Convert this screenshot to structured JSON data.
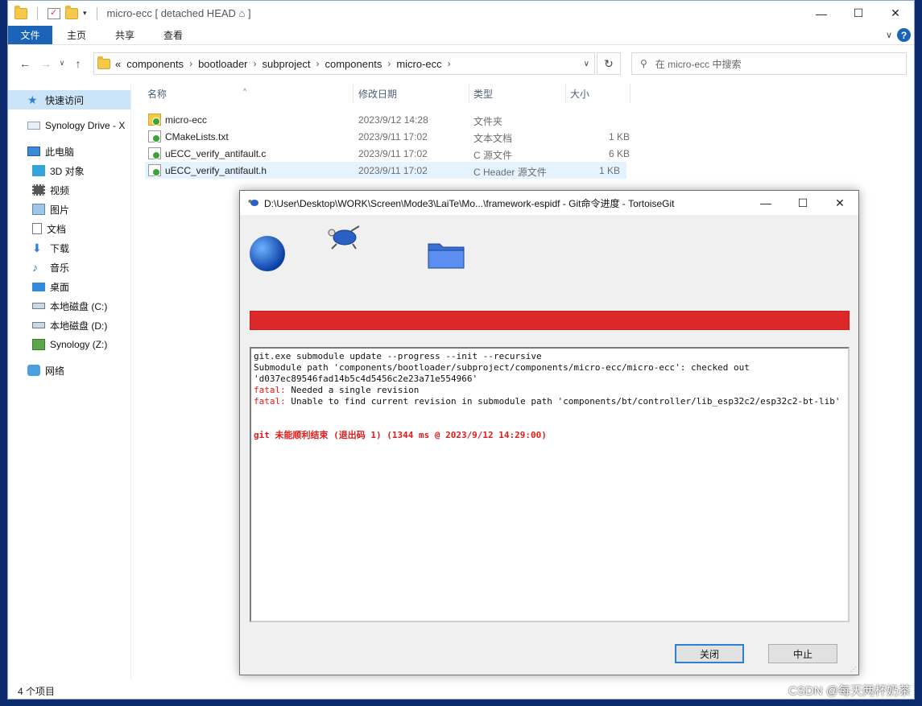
{
  "explorer": {
    "title": "micro-ecc [ detached HEAD ⌂ ]",
    "window_controls": {
      "minimize": "—",
      "maximize": "☐",
      "close": "✕"
    },
    "ribbon": {
      "file": "文件",
      "home": "主页",
      "share": "共享",
      "view": "查看",
      "expand": "∨",
      "help": "?"
    },
    "nav": {
      "back": "←",
      "forward": "→",
      "dropdown": "∨",
      "up": "↑"
    },
    "address": {
      "overflow": "«",
      "segments": [
        "components",
        "bootloader",
        "subproject",
        "components",
        "micro-ecc"
      ],
      "dropdown": "∨"
    },
    "refresh": "↻",
    "search": {
      "placeholder": "在 micro-ecc 中搜索"
    },
    "sidebar": {
      "quick_access": "快速访问",
      "synology_drive": "Synology Drive - X",
      "this_pc": "此电脑",
      "items": [
        "3D 对象",
        "视频",
        "图片",
        "文档",
        "下载",
        "音乐",
        "桌面",
        "本地磁盘 (C:)",
        "本地磁盘 (D:)",
        "Synology (Z:)"
      ],
      "network": "网络"
    },
    "columns": {
      "name": "名称",
      "modified": "修改日期",
      "type": "类型",
      "size": "大小"
    },
    "files": [
      {
        "name": "micro-ecc",
        "modified": "2023/9/12 14:28",
        "type": "文件夹",
        "size": ""
      },
      {
        "name": "CMakeLists.txt",
        "modified": "2023/9/11 17:02",
        "type": "文本文档",
        "size": "1 KB"
      },
      {
        "name": "uECC_verify_antifault.c",
        "modified": "2023/9/11 17:02",
        "type": "C 源文件",
        "size": "6 KB"
      },
      {
        "name": "uECC_verify_antifault.h",
        "modified": "2023/9/11 17:02",
        "type": "C Header 源文件",
        "size": "1 KB"
      }
    ],
    "status": "4 个项目"
  },
  "dialog": {
    "title": "D:\\User\\Desktop\\WORK\\Screen\\Mode3\\LaiTe\\Mo...\\framework-espidf - Git命令进度 - TortoiseGit",
    "controls": {
      "minimize": "—",
      "maximize": "☐",
      "close": "✕"
    },
    "progress": 1.0,
    "log": {
      "l1": "git.exe submodule update --progress --init --recursive",
      "l2": "Submodule path 'components/bootloader/subproject/components/micro-ecc/micro-ecc': checked out 'd037ec89546fad14b5c4d5456c2e23a71e554966'",
      "fatal_label": "fatal:",
      "l3": " Needed a single revision",
      "l4": " Unable to find current revision in submodule path 'components/bt/controller/lib_esp32c2/esp32c2-bt-lib'",
      "result": "git 未能顺利结束 (退出码 1) (1344 ms @ 2023/9/12 14:29:00)"
    },
    "buttons": {
      "close": "关闭",
      "stop": "中止"
    }
  },
  "watermark": "CSDN @每天两杯奶茶",
  "colors": {
    "progress_fail": "#dc2828",
    "accent": "#1a63b6",
    "error_text": "#e31a1a"
  }
}
